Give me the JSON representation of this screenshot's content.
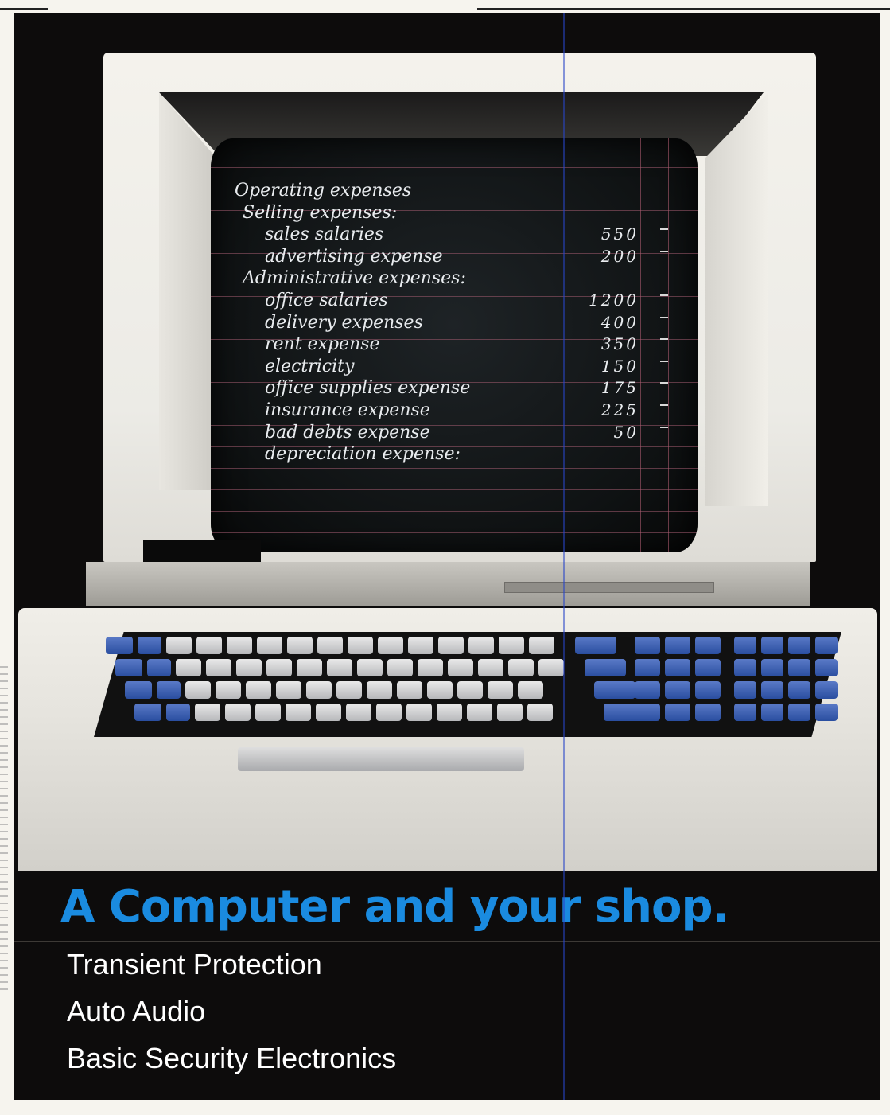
{
  "ad": {
    "headline": "A Computer and your shop.",
    "items": [
      {
        "label": "Transient Protection"
      },
      {
        "label": "Auto Audio"
      },
      {
        "label": "Basic Security Electronics"
      }
    ]
  },
  "screen": {
    "rows": [
      {
        "text": "Operating expenses",
        "indent": 0,
        "amount": ""
      },
      {
        "text": "Selling expenses:",
        "indent": 1,
        "amount": ""
      },
      {
        "text": "sales salaries",
        "indent": 2,
        "amount": "550"
      },
      {
        "text": "advertising expense",
        "indent": 2,
        "amount": "200"
      },
      {
        "text": "Administrative expenses:",
        "indent": 1,
        "amount": ""
      },
      {
        "text": "office salaries",
        "indent": 2,
        "amount": "1200"
      },
      {
        "text": "delivery expenses",
        "indent": 2,
        "amount": "400"
      },
      {
        "text": "rent expense",
        "indent": 2,
        "amount": "350"
      },
      {
        "text": "electricity",
        "indent": 2,
        "amount": "150"
      },
      {
        "text": "office supplies expense",
        "indent": 2,
        "amount": "175"
      },
      {
        "text": "insurance expense",
        "indent": 2,
        "amount": "225"
      },
      {
        "text": "bad debts expense",
        "indent": 2,
        "amount": "50"
      },
      {
        "text": "depreciation expense:",
        "indent": 2,
        "amount": ""
      }
    ]
  },
  "colors": {
    "headline": "#1a8be0",
    "background": "#0d0c0c",
    "key_blue": "#2a4ea0",
    "key_gray": "#b7b8bb"
  }
}
